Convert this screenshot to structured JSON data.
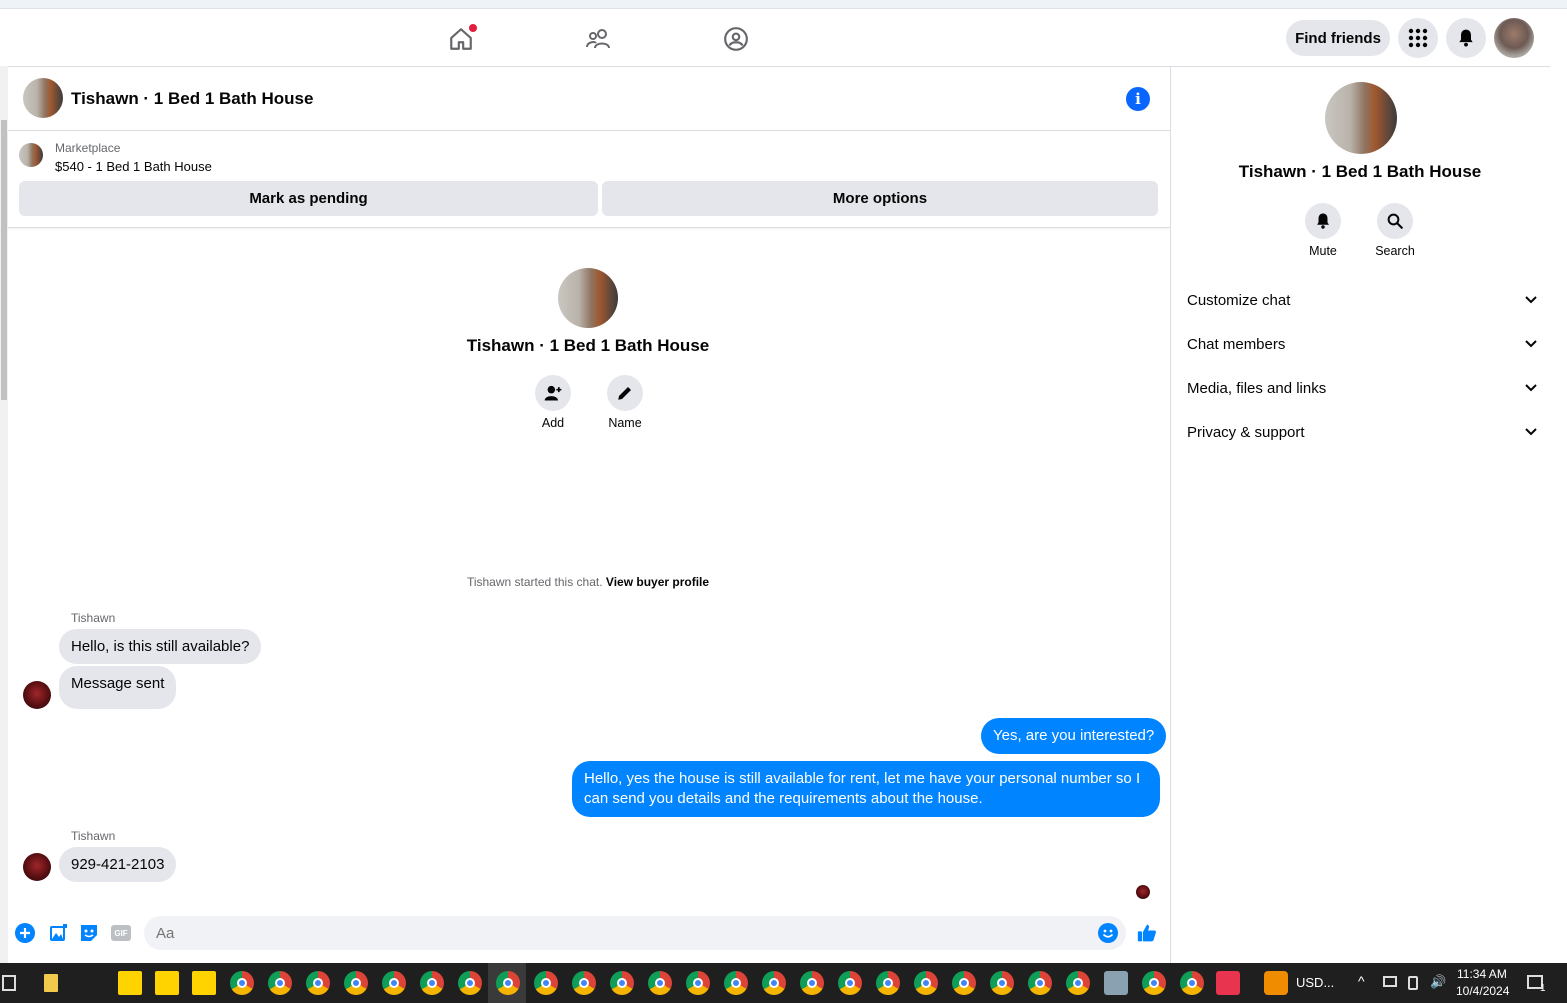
{
  "header": {
    "find_friends_label": "Find friends"
  },
  "chat": {
    "title": "Tishawn · 1 Bed 1 Bath House",
    "listing": {
      "category": "Marketplace",
      "description": "$540 - 1 Bed 1 Bath House",
      "mark_pending_label": "Mark as pending",
      "more_options_label": "More options"
    },
    "profile": {
      "name": "Tishawn · 1 Bed 1 Bath House",
      "add_label": "Add",
      "name_label": "Name"
    },
    "started_note": "Tishawn started this chat.",
    "view_buyer_profile": "View buyer profile",
    "messages": [
      {
        "sender": "Tishawn",
        "text": "Hello, is this still available?"
      },
      {
        "text": "Message sent"
      },
      {
        "text": "Yes, are you interested?"
      },
      {
        "text": "Hello, yes the house is still available for rent, let me have your personal number so I can send you details and the requirements about the house."
      },
      {
        "sender": "Tishawn",
        "text": "929-421-2103"
      }
    ],
    "composer": {
      "placeholder": "Aa",
      "gif_label": "GIF"
    }
  },
  "right_panel": {
    "name": "Tishawn · 1 Bed 1 Bath House",
    "mute_label": "Mute",
    "search_label": "Search",
    "sections": [
      "Customize chat",
      "Chat members",
      "Media, files and links",
      "Privacy & support"
    ]
  },
  "taskbar": {
    "currency_label": "USD...",
    "time": "11:34 AM",
    "date": "10/4/2024",
    "notification_count": "1"
  },
  "colors": {
    "accent": "#0084ff",
    "bubble_in": "#e4e6eb",
    "nav_badge": "#e41e3f"
  }
}
